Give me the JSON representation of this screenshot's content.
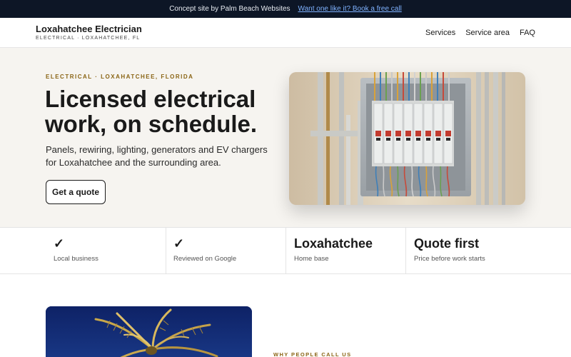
{
  "topbar": {
    "text": "Concept site by Palm Beach Websites",
    "link": "Want one like it? Book a free call"
  },
  "header": {
    "brand_name": "Loxahatchee Electrician",
    "brand_sub": "ELECTRICAL · LOXAHATCHEE, FL",
    "nav": [
      "Services",
      "Service area",
      "FAQ"
    ]
  },
  "hero": {
    "eyebrow": "ELECTRICAL · LOXAHATCHEE, FLORIDA",
    "title": "Licensed electrical work, on schedule.",
    "description": "Panels, rewiring, lighting, generators and EV chargers for Loxahatchee and the surrounding area.",
    "cta": "Get a quote",
    "image_icon": "electrical-panel-photo"
  },
  "stats": [
    {
      "main": "✓",
      "sub": "Local business"
    },
    {
      "main": "✓",
      "sub": "Reviewed on Google"
    },
    {
      "main": "Loxahatchee",
      "sub": "Home base"
    },
    {
      "main": "Quote first",
      "sub": "Price before work starts"
    }
  ],
  "section": {
    "eyebrow": "WHY PEOPLE CALL US",
    "image_icon": "palm-tree-photo"
  },
  "colors": {
    "topbar_bg": "#0d1626",
    "link": "#7fb2ff",
    "accent": "#8a6414",
    "hero_bg": "#f6f4f0"
  }
}
